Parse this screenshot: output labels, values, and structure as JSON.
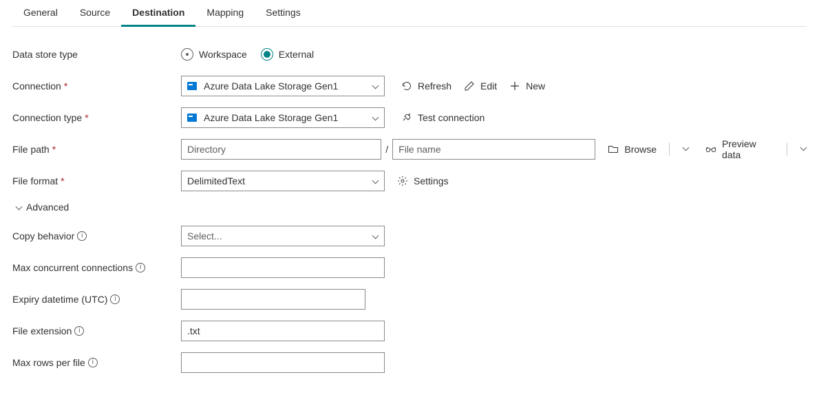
{
  "tabs": {
    "general": "General",
    "source": "Source",
    "destination": "Destination",
    "mapping": "Mapping",
    "settings": "Settings",
    "active": "destination"
  },
  "labels": {
    "dataStoreType": "Data store type",
    "connection": "Connection",
    "connectionType": "Connection type",
    "filePath": "File path",
    "fileFormat": "File format",
    "advanced": "Advanced",
    "copyBehavior": "Copy behavior",
    "maxConcurrent": "Max concurrent connections",
    "expiry": "Expiry datetime (UTC)",
    "fileExtension": "File extension",
    "maxRows": "Max rows per file"
  },
  "radios": {
    "workspace": "Workspace",
    "external": "External",
    "selected": "external"
  },
  "connection": {
    "value": "Azure Data Lake Storage Gen1"
  },
  "connectionType": {
    "value": "Azure Data Lake Storage Gen1"
  },
  "filePath": {
    "dirPlaceholder": "Directory",
    "dirValue": "",
    "filePlaceholder": "File name",
    "fileValue": ""
  },
  "fileFormat": {
    "value": "DelimitedText"
  },
  "copyBehavior": {
    "placeholder": "Select..."
  },
  "fields": {
    "maxConcurrent": "",
    "expiry": "",
    "fileExtension": ".txt",
    "maxRows": ""
  },
  "actions": {
    "refresh": "Refresh",
    "edit": "Edit",
    "new": "New",
    "testConnection": "Test connection",
    "browse": "Browse",
    "previewData": "Preview data",
    "settings": "Settings"
  }
}
